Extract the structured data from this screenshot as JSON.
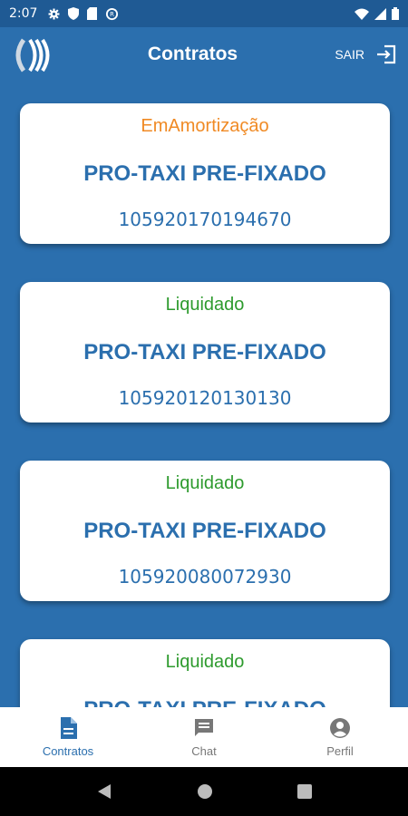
{
  "status_bar": {
    "time": "2:07"
  },
  "header": {
    "title": "Contratos",
    "logout_label": "SAIR"
  },
  "contracts": [
    {
      "status": "EmAmortização",
      "status_color": "#f08a24",
      "product": "PRO-TAXI PRE-FIXADO",
      "number": "105920170194670"
    },
    {
      "status": "Liquidado",
      "status_color": "#2e9b2e",
      "product": "PRO-TAXI PRE-FIXADO",
      "number": "105920120130130"
    },
    {
      "status": "Liquidado",
      "status_color": "#2e9b2e",
      "product": "PRO-TAXI PRE-FIXADO",
      "number": "105920080072930"
    },
    {
      "status": "Liquidado",
      "status_color": "#2e9b2e",
      "product": "PRO-TAXI PRE-FIXADO",
      "number": ""
    }
  ],
  "bottom_nav": [
    {
      "label": "Contratos",
      "icon": "document-icon",
      "active": true
    },
    {
      "label": "Chat",
      "icon": "chat-icon",
      "active": false
    },
    {
      "label": "Perfil",
      "icon": "account-circle-icon",
      "active": false
    }
  ],
  "colors": {
    "primary": "#2b6fae",
    "amortizacao": "#f08a24",
    "liquidado": "#2e9b2e"
  }
}
